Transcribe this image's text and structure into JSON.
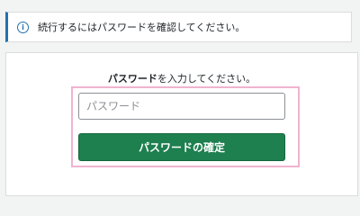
{
  "notice": {
    "icon": "info-icon",
    "icon_glyph": "i",
    "text": "続行するにはパスワードを確認してください。"
  },
  "form": {
    "prompt_bold": "パスワード",
    "prompt_rest": "を入力してください。",
    "password_placeholder": "パスワード",
    "password_value": "",
    "confirm_label": "パスワードの確定"
  },
  "colors": {
    "accent": "#2271b1",
    "button": "#1e7f4f",
    "highlight": "#f0b3cf"
  }
}
